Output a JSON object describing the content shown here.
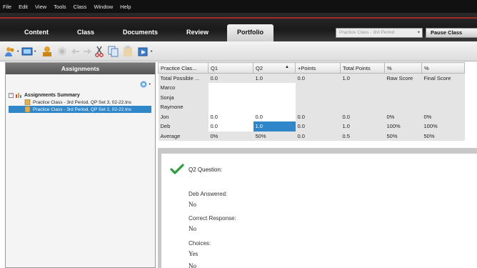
{
  "menubar": {
    "items": [
      "File",
      "Edit",
      "View",
      "Tools",
      "Class",
      "Window",
      "Help"
    ]
  },
  "tabs": {
    "items": [
      "Content",
      "Class",
      "Documents",
      "Review",
      "Portfolio"
    ],
    "active": "Portfolio"
  },
  "class_selector": {
    "value": "Practice Class - 3rd Period"
  },
  "pause_button": {
    "label": "Pause Class"
  },
  "toolbar": {
    "icons": [
      "users-icon",
      "screen-capture-icon",
      "quick-poll-icon",
      "help-icon",
      "undo-icon",
      "redo-icon",
      "cut-icon",
      "copy-icon",
      "paste-icon",
      "send-icon"
    ]
  },
  "left_panel": {
    "title": "Assignments",
    "summary_label": "Assignments Summary",
    "items": [
      "Practice Class - 3rd Period, QP Set 3, 02-22.tns",
      "Practice Class - 3rd Period, QP Set 2, 02-22.tns"
    ],
    "selected_index": 1
  },
  "grid": {
    "columns": [
      "Practice Clas...",
      "Q1",
      "Q2",
      "+Points",
      "Total Points",
      "%",
      "%"
    ],
    "rows": [
      [
        "Total Possible ...",
        "0.0",
        "1.0",
        "0.0",
        "1.0",
        "Raw Score",
        "Final Score"
      ],
      [
        "Marco",
        "",
        "",
        "",
        "",
        "",
        ""
      ],
      [
        "Sonja",
        "",
        "",
        "",
        "",
        "",
        ""
      ],
      [
        "Raymone",
        "",
        "",
        "",
        "",
        "",
        ""
      ],
      [
        "Jon",
        "0.0",
        "0.0",
        "0.0",
        "0.0",
        "0%",
        "0%"
      ],
      [
        "Deb",
        "0.0",
        "1.0",
        "0.0",
        "1.0",
        "100%",
        "100%"
      ],
      [
        "Average",
        "0%",
        "50%",
        "0.0",
        "0.5",
        "50%",
        "50%"
      ]
    ],
    "highlight": {
      "row": 5,
      "col": 2
    }
  },
  "detail": {
    "question_title": "Q2 Question:",
    "answered_label": "Deb Answered:",
    "answered_value": "No",
    "correct_label": "Correct Response:",
    "correct_value": "No",
    "choices_label": "Choices:",
    "choices_values": [
      "Yes",
      "No"
    ]
  },
  "colors": {
    "selection": "#2f86c9",
    "checkmark": "#2e9e3a",
    "tab_accent": "#a52a2a"
  }
}
